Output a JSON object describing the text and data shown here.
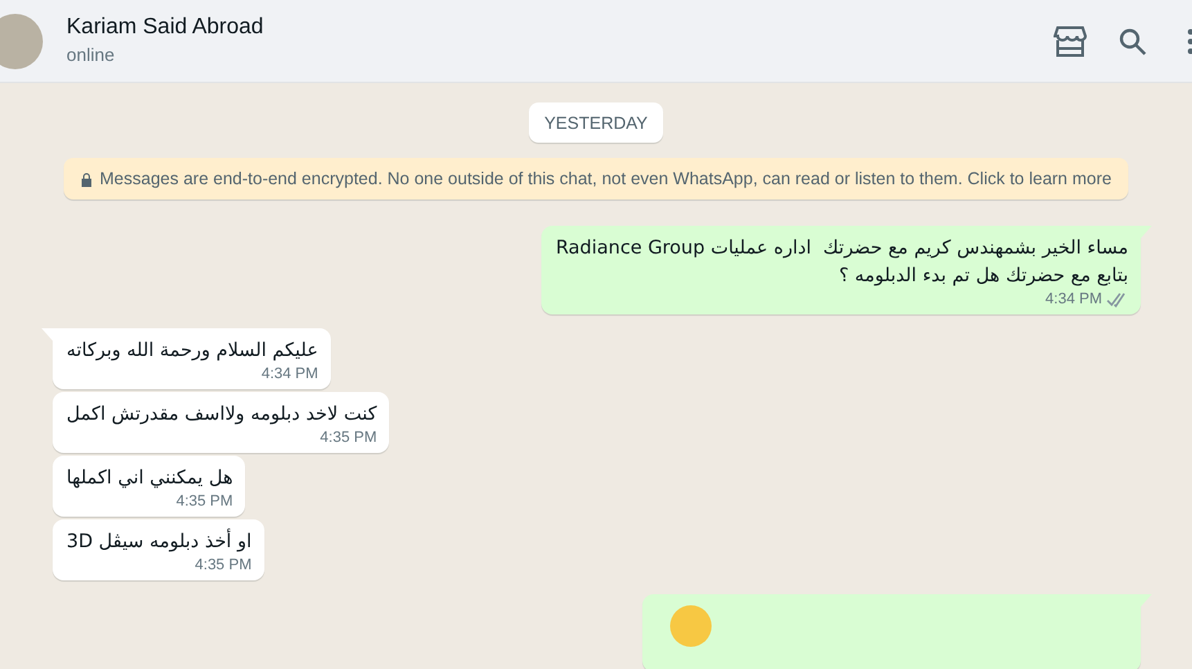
{
  "header": {
    "name": "Kariam Said Abroad",
    "status": "online"
  },
  "date_divider": "YESTERDAY",
  "encryption_notice": "Messages are end-to-end encrypted. No one outside of this chat, not even WhatsApp, can read or listen to them. Click to learn more",
  "messages": [
    {
      "kind": "out",
      "lines": [
        "مساء الخير بشمهندس كريم مع حضرتك  اداره عمليات Radiance Group",
        "بتابع مع حضرتك هل تم بدء الدبلومه ؟"
      ],
      "time": "4:34 PM",
      "read": true,
      "tail": true
    },
    {
      "kind": "in",
      "lines": [
        "عليكم السلام ورحمة الله وبركاته"
      ],
      "time": "4:34 PM",
      "tail": true
    },
    {
      "kind": "in",
      "lines": [
        "كنت لاخد دبلومه ولااسف مقدرتش اكمل"
      ],
      "time": "4:35 PM",
      "tail": false
    },
    {
      "kind": "in",
      "lines": [
        "هل يمكنني اني اكملها"
      ],
      "time": "4:35 PM",
      "tail": false
    },
    {
      "kind": "in",
      "lines": [
        "او أخذ دبلومه سيڤل 3D"
      ],
      "time": "4:35 PM",
      "tail": false
    },
    {
      "kind": "partial",
      "tail": true
    }
  ]
}
